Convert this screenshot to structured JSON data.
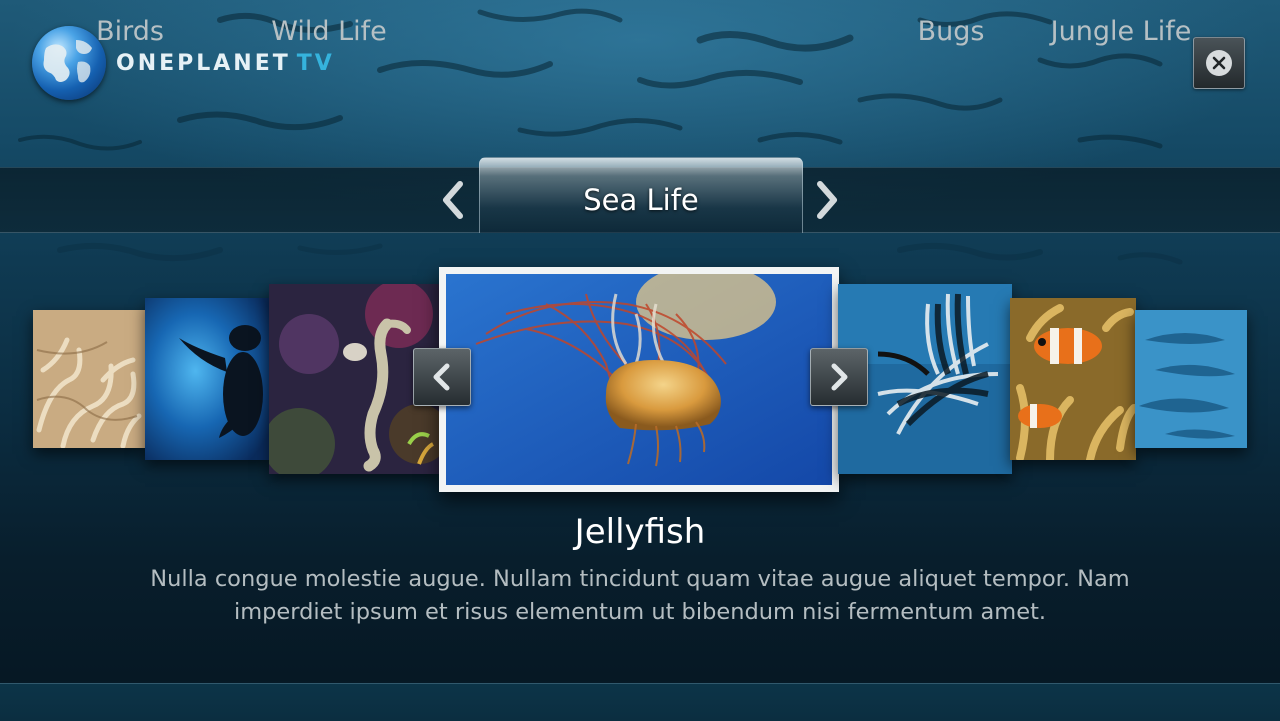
{
  "app": {
    "brand_main": "ONEPLANET",
    "brand_suffix": "TV",
    "accent_color": "#35b3dd"
  },
  "header": {
    "close_icon": "close-icon"
  },
  "categories": {
    "items": [
      {
        "label": "Birds"
      },
      {
        "label": "Wild Life"
      },
      {
        "label": "Sea Life"
      },
      {
        "label": "Bugs"
      },
      {
        "label": "Jungle Life"
      }
    ],
    "selected": "Sea Life",
    "prev_icon": "chevron-left-icon",
    "next_icon": "chevron-right-icon"
  },
  "carousel": {
    "thumbnails": [
      "coral",
      "sea turtle",
      "seahorse",
      "jellyfish",
      "lionfish",
      "clownfish",
      "dolphins"
    ],
    "selected_thumbnail": "jellyfish",
    "prev_icon": "chevron-left-icon",
    "next_icon": "chevron-right-icon"
  },
  "detail": {
    "title": "Jellyfish",
    "description": "Nulla congue molestie augue. Nullam tincidunt quam vitae augue aliquet tempor. Nam imperdiet ipsum et risus elementum ut bibendum nisi fermentum amet."
  }
}
